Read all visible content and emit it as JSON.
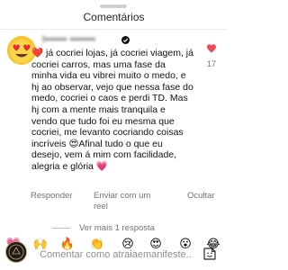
{
  "sheet": {
    "title": "Comentários"
  },
  "comment": {
    "username": "t•••••• •••••••",
    "text_parts": [
      "❤️",
      " já cocriei lojas, já cocriei viagem, já cocriei carros, mas uma fase da minha vida eu vibrei muito o medo, e hj ao observar, vejo que nessa fase do medo, cocriei o caos e perdi TD. Mas hj com a mente mais  tranquila e vendo que tudo foi eu mesma que cocriei, me levanto cocriando coisas incríveis ",
      "😍",
      "Afinal tudo o que eu desejo, vem á mim com facilidade, alegria e glória ",
      "💗"
    ],
    "like_count": "17",
    "actions": {
      "reply": "Responder",
      "share": "Enviar com um reel",
      "hide": "Ocultar"
    },
    "view_replies": "Ver mais 1 resposta"
  },
  "reactions": [
    "🙌",
    "🔥",
    "👏",
    "😢",
    "😍",
    "😮",
    "😂"
  ],
  "composer": {
    "placeholder": "Comentar como atraiaemanifeste...",
    "value": ""
  },
  "colors": {
    "like": "#ed4956",
    "muted": "#737373",
    "avatar_bg": "#f7c531"
  }
}
